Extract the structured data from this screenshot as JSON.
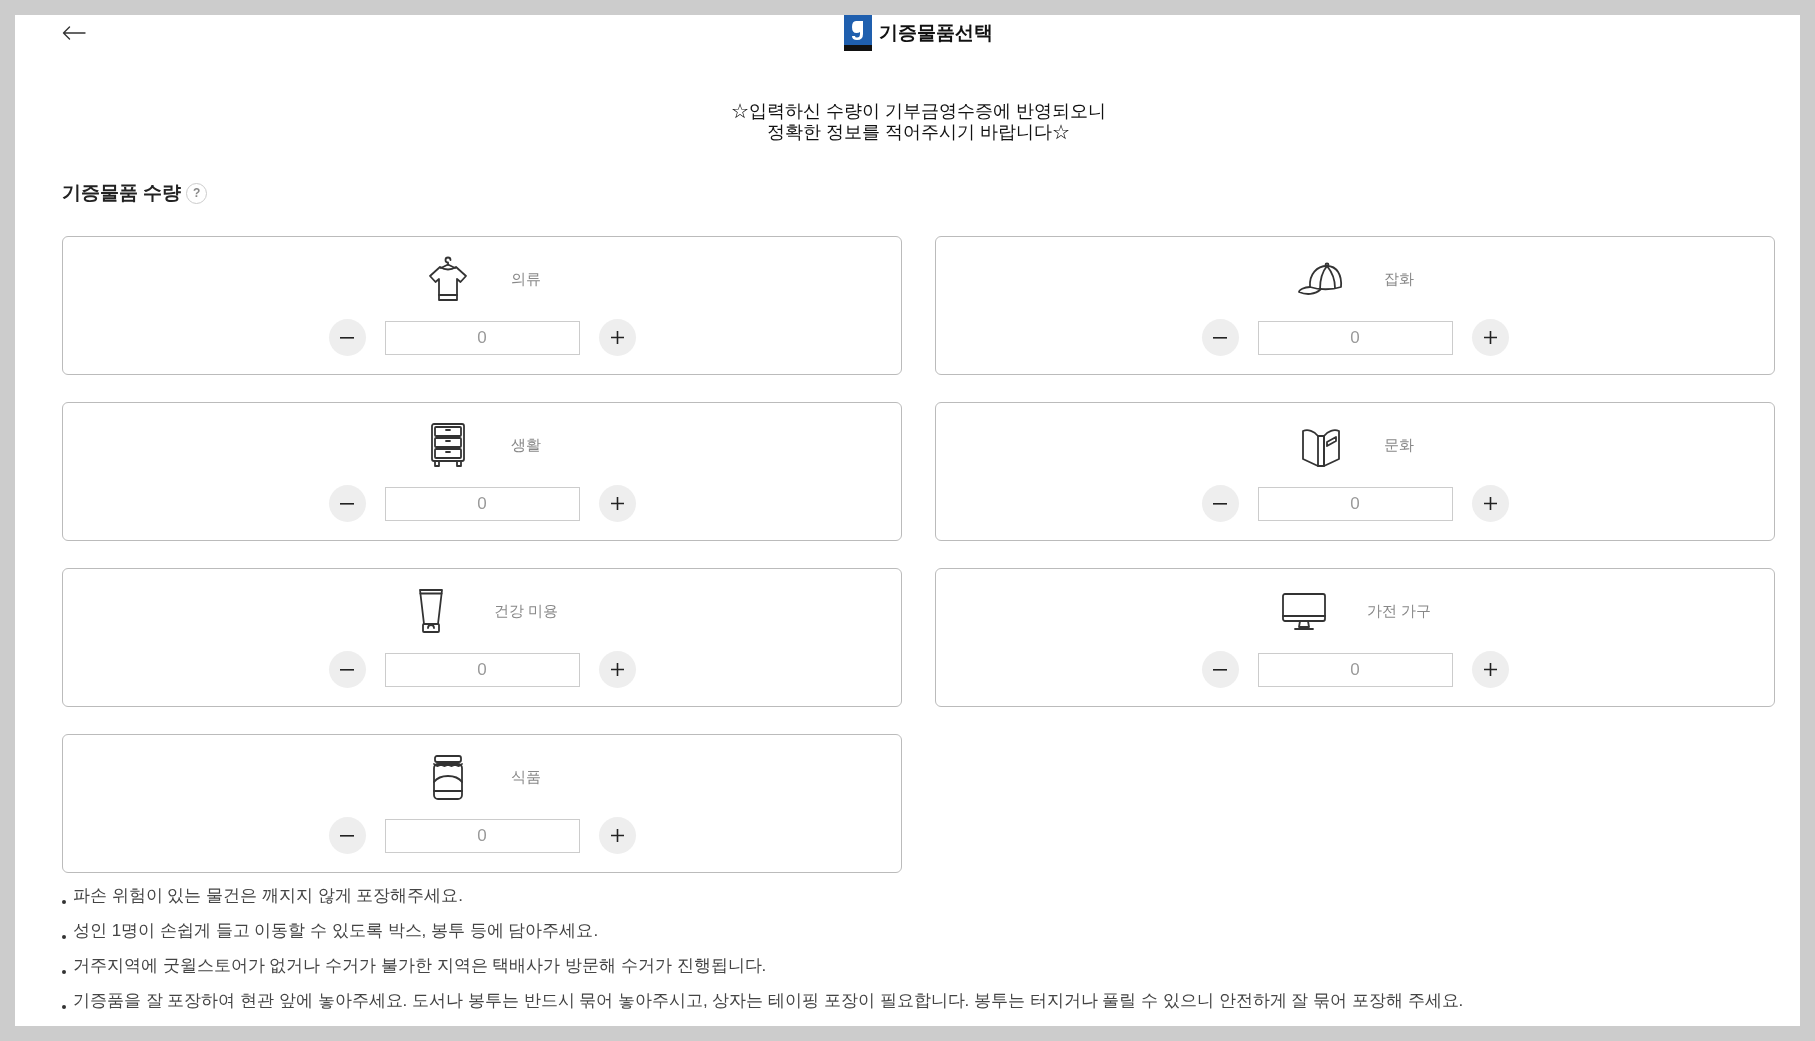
{
  "header": {
    "title": "기증물품선택"
  },
  "notice": {
    "lines": [
      "☆입력하신 수량이 기부금영수증에 반영되오니",
      "정확한 정보를 적어주시기 바랍니다☆"
    ]
  },
  "section": {
    "title": "기증물품 수량",
    "help": "?"
  },
  "categories": [
    {
      "kind": "shirt",
      "label": "의류",
      "value": "0"
    },
    {
      "kind": "cap",
      "label": "잡화",
      "value": "0"
    },
    {
      "kind": "drawers",
      "label": "생활",
      "value": "0"
    },
    {
      "kind": "book",
      "label": "문화",
      "value": "0"
    },
    {
      "kind": "tube",
      "label": "건강 미용",
      "value": "0"
    },
    {
      "kind": "monitor",
      "label": "가전 가구",
      "value": "0"
    },
    {
      "kind": "jar",
      "label": "식품",
      "value": "0"
    }
  ],
  "notes": [
    "파손 위험이 있는 물건은 깨지지 않게 포장해주세요.",
    "성인 1명이 손쉽게 들고 이동할 수 있도록 박스, 봉투 등에 담아주세요.",
    "거주지역에 굿윌스토어가 없거나 수거가 불가한 지역은 택배사가 방문해 수거가 진행됩니다.",
    "기증품을 잘 포장하여 현관 앞에 놓아주세요. 도서나 봉투는 반드시 묶어 놓아주시고, 상자는 테이핑 포장이 필요합니다. 봉투는 터지거나 풀릴 수 있으니 안전하게 잘 묶어 포장해 주세요."
  ]
}
